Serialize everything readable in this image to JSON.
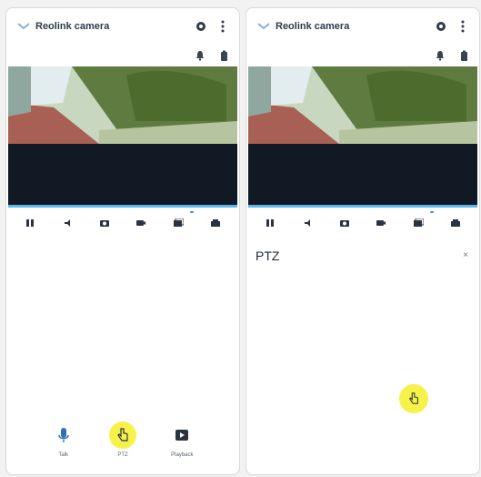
{
  "left_screen": {
    "title": "Reolink camera",
    "bitrate": "  ",
    "bottom_nav": [
      {
        "label": "Talk",
        "icon": "microphone-icon"
      },
      {
        "label": "PTZ",
        "icon": "hand-pointer-icon"
      },
      {
        "label": "Playback",
        "icon": "playback-icon"
      }
    ]
  },
  "right_screen": {
    "title": "Reolink camera",
    "bitrate": "  ",
    "panel_title": "PTZ",
    "close_label": "×"
  },
  "controls": [
    {
      "icon": "pause-icon"
    },
    {
      "icon": "speaker-icon"
    },
    {
      "icon": "camera-icon"
    },
    {
      "icon": "record-icon"
    },
    {
      "icon": "multi-view-icon"
    },
    {
      "icon": "quality-icon"
    }
  ],
  "colors": {
    "accent": "#5ab9e8",
    "highlight": "#f6f24a",
    "header_text": "#2f3b4a"
  }
}
